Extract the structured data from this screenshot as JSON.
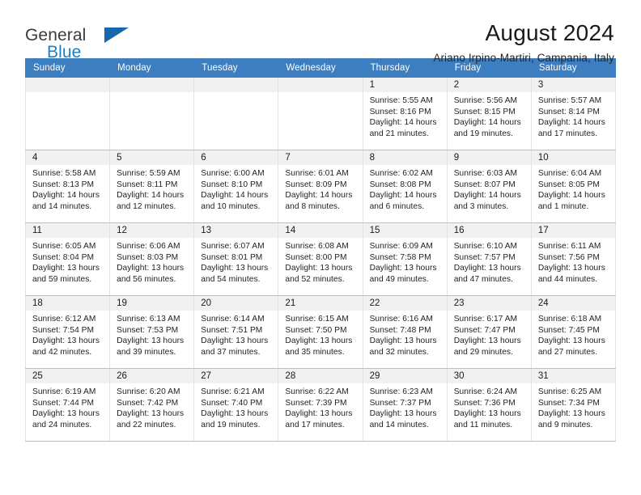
{
  "brand": {
    "name_top": "General",
    "name_bottom": "Blue",
    "accent_color": "#1368b0",
    "text_color": "#3c3c3c"
  },
  "header": {
    "title": "August 2024",
    "subtitle": "Ariano Irpino-Martiri, Campania, Italy"
  },
  "calendar": {
    "header_bg": "#3c7ebf",
    "daynum_bg": "#f1f1f1",
    "weekday_headers": [
      "Sunday",
      "Monday",
      "Tuesday",
      "Wednesday",
      "Thursday",
      "Friday",
      "Saturday"
    ],
    "weeks": [
      [
        {
          "day": "",
          "lines": []
        },
        {
          "day": "",
          "lines": []
        },
        {
          "day": "",
          "lines": []
        },
        {
          "day": "",
          "lines": []
        },
        {
          "day": "1",
          "lines": [
            "Sunrise: 5:55 AM",
            "Sunset: 8:16 PM",
            "Daylight: 14 hours",
            "and 21 minutes."
          ]
        },
        {
          "day": "2",
          "lines": [
            "Sunrise: 5:56 AM",
            "Sunset: 8:15 PM",
            "Daylight: 14 hours",
            "and 19 minutes."
          ]
        },
        {
          "day": "3",
          "lines": [
            "Sunrise: 5:57 AM",
            "Sunset: 8:14 PM",
            "Daylight: 14 hours",
            "and 17 minutes."
          ]
        }
      ],
      [
        {
          "day": "4",
          "lines": [
            "Sunrise: 5:58 AM",
            "Sunset: 8:13 PM",
            "Daylight: 14 hours",
            "and 14 minutes."
          ]
        },
        {
          "day": "5",
          "lines": [
            "Sunrise: 5:59 AM",
            "Sunset: 8:11 PM",
            "Daylight: 14 hours",
            "and 12 minutes."
          ]
        },
        {
          "day": "6",
          "lines": [
            "Sunrise: 6:00 AM",
            "Sunset: 8:10 PM",
            "Daylight: 14 hours",
            "and 10 minutes."
          ]
        },
        {
          "day": "7",
          "lines": [
            "Sunrise: 6:01 AM",
            "Sunset: 8:09 PM",
            "Daylight: 14 hours",
            "and 8 minutes."
          ]
        },
        {
          "day": "8",
          "lines": [
            "Sunrise: 6:02 AM",
            "Sunset: 8:08 PM",
            "Daylight: 14 hours",
            "and 6 minutes."
          ]
        },
        {
          "day": "9",
          "lines": [
            "Sunrise: 6:03 AM",
            "Sunset: 8:07 PM",
            "Daylight: 14 hours",
            "and 3 minutes."
          ]
        },
        {
          "day": "10",
          "lines": [
            "Sunrise: 6:04 AM",
            "Sunset: 8:05 PM",
            "Daylight: 14 hours",
            "and 1 minute."
          ]
        }
      ],
      [
        {
          "day": "11",
          "lines": [
            "Sunrise: 6:05 AM",
            "Sunset: 8:04 PM",
            "Daylight: 13 hours",
            "and 59 minutes."
          ]
        },
        {
          "day": "12",
          "lines": [
            "Sunrise: 6:06 AM",
            "Sunset: 8:03 PM",
            "Daylight: 13 hours",
            "and 56 minutes."
          ]
        },
        {
          "day": "13",
          "lines": [
            "Sunrise: 6:07 AM",
            "Sunset: 8:01 PM",
            "Daylight: 13 hours",
            "and 54 minutes."
          ]
        },
        {
          "day": "14",
          "lines": [
            "Sunrise: 6:08 AM",
            "Sunset: 8:00 PM",
            "Daylight: 13 hours",
            "and 52 minutes."
          ]
        },
        {
          "day": "15",
          "lines": [
            "Sunrise: 6:09 AM",
            "Sunset: 7:58 PM",
            "Daylight: 13 hours",
            "and 49 minutes."
          ]
        },
        {
          "day": "16",
          "lines": [
            "Sunrise: 6:10 AM",
            "Sunset: 7:57 PM",
            "Daylight: 13 hours",
            "and 47 minutes."
          ]
        },
        {
          "day": "17",
          "lines": [
            "Sunrise: 6:11 AM",
            "Sunset: 7:56 PM",
            "Daylight: 13 hours",
            "and 44 minutes."
          ]
        }
      ],
      [
        {
          "day": "18",
          "lines": [
            "Sunrise: 6:12 AM",
            "Sunset: 7:54 PM",
            "Daylight: 13 hours",
            "and 42 minutes."
          ]
        },
        {
          "day": "19",
          "lines": [
            "Sunrise: 6:13 AM",
            "Sunset: 7:53 PM",
            "Daylight: 13 hours",
            "and 39 minutes."
          ]
        },
        {
          "day": "20",
          "lines": [
            "Sunrise: 6:14 AM",
            "Sunset: 7:51 PM",
            "Daylight: 13 hours",
            "and 37 minutes."
          ]
        },
        {
          "day": "21",
          "lines": [
            "Sunrise: 6:15 AM",
            "Sunset: 7:50 PM",
            "Daylight: 13 hours",
            "and 35 minutes."
          ]
        },
        {
          "day": "22",
          "lines": [
            "Sunrise: 6:16 AM",
            "Sunset: 7:48 PM",
            "Daylight: 13 hours",
            "and 32 minutes."
          ]
        },
        {
          "day": "23",
          "lines": [
            "Sunrise: 6:17 AM",
            "Sunset: 7:47 PM",
            "Daylight: 13 hours",
            "and 29 minutes."
          ]
        },
        {
          "day": "24",
          "lines": [
            "Sunrise: 6:18 AM",
            "Sunset: 7:45 PM",
            "Daylight: 13 hours",
            "and 27 minutes."
          ]
        }
      ],
      [
        {
          "day": "25",
          "lines": [
            "Sunrise: 6:19 AM",
            "Sunset: 7:44 PM",
            "Daylight: 13 hours",
            "and 24 minutes."
          ]
        },
        {
          "day": "26",
          "lines": [
            "Sunrise: 6:20 AM",
            "Sunset: 7:42 PM",
            "Daylight: 13 hours",
            "and 22 minutes."
          ]
        },
        {
          "day": "27",
          "lines": [
            "Sunrise: 6:21 AM",
            "Sunset: 7:40 PM",
            "Daylight: 13 hours",
            "and 19 minutes."
          ]
        },
        {
          "day": "28",
          "lines": [
            "Sunrise: 6:22 AM",
            "Sunset: 7:39 PM",
            "Daylight: 13 hours",
            "and 17 minutes."
          ]
        },
        {
          "day": "29",
          "lines": [
            "Sunrise: 6:23 AM",
            "Sunset: 7:37 PM",
            "Daylight: 13 hours",
            "and 14 minutes."
          ]
        },
        {
          "day": "30",
          "lines": [
            "Sunrise: 6:24 AM",
            "Sunset: 7:36 PM",
            "Daylight: 13 hours",
            "and 11 minutes."
          ]
        },
        {
          "day": "31",
          "lines": [
            "Sunrise: 6:25 AM",
            "Sunset: 7:34 PM",
            "Daylight: 13 hours",
            "and 9 minutes."
          ]
        }
      ]
    ]
  }
}
